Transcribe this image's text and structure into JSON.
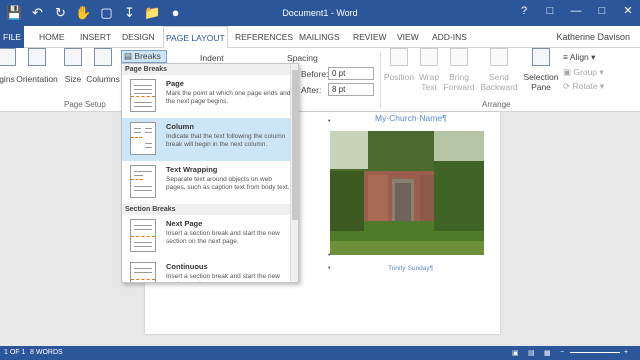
{
  "window": {
    "title": "Document1 - Word",
    "quick_access": [
      "save-icon",
      "undo-icon",
      "redo-icon",
      "touch-mode-icon",
      "new-icon",
      "download-icon",
      "open-icon",
      "circle-icon"
    ]
  },
  "tabs": [
    {
      "label": "FILE"
    },
    {
      "label": "HOME"
    },
    {
      "label": "INSERT"
    },
    {
      "label": "DESIGN"
    },
    {
      "label": "PAGE LAYOUT"
    },
    {
      "label": "REFERENCES"
    },
    {
      "label": "MAILINGS"
    },
    {
      "label": "REVIEW"
    },
    {
      "label": "VIEW"
    },
    {
      "label": "ADD-INS"
    }
  ],
  "user": "Katherine Davison",
  "ribbon": {
    "margins": "gins",
    "orientation": "Orientation",
    "size": "Size",
    "columns": "Columns",
    "breaks": "Breaks",
    "page_setup": "Page Setup",
    "indent": "Indent",
    "spacing": "Spacing",
    "before_label": "Before:",
    "before_value": "0 pt",
    "after_label": "After:",
    "after_value": "8 pt",
    "position": "Position",
    "wrap_text": [
      "Wrap",
      "Text"
    ],
    "bring_forward": [
      "Bring",
      "Forward"
    ],
    "send_backward": [
      "Send",
      "Backward"
    ],
    "selection_pane": [
      "Selection",
      "Pane"
    ],
    "align": "Align",
    "group": "Group",
    "rotate": "Rotate",
    "arrange": "Arrange"
  },
  "breaks_menu": {
    "page_breaks_header": "Page Breaks",
    "section_breaks_header": "Section Breaks",
    "items": [
      {
        "title": "Page",
        "desc": "Mark the point at which one page ends and the next page begins."
      },
      {
        "title": "Column",
        "desc": "Indicate that the text following the column break will begin in the next column."
      },
      {
        "title": "Text Wrapping",
        "desc": "Separate text around objects on web pages, such as caption text from body text."
      },
      {
        "title": "Next Page",
        "desc": "Insert a section break and start the new section on the next page."
      },
      {
        "title": "Continuous",
        "desc": "Insert a section break and start the new section on the same page."
      }
    ]
  },
  "document": {
    "heading": "My·Church·Name¶",
    "caption": "Trinity·Sunday¶"
  },
  "status": {
    "page": "1 OF 1",
    "words": "8 WORDS"
  },
  "colors": {
    "accent": "#2b579a",
    "hover": "#cde6f7",
    "heading": "#5b8bc9"
  }
}
